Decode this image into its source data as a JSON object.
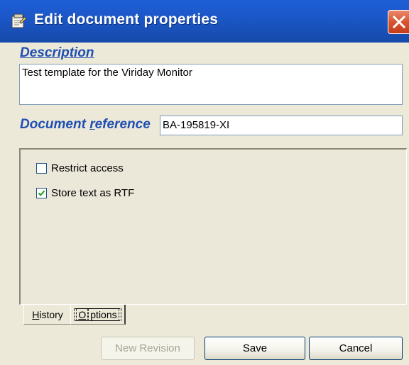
{
  "window": {
    "title": "Edit document properties",
    "icons": {
      "app": "properties-icon",
      "close": "close-icon"
    }
  },
  "description": {
    "label": "Description",
    "value": "Test template for the Viriday Monitor"
  },
  "reference": {
    "label_prefix": "Document ",
    "label_hotkey": "r",
    "label_suffix": "eference",
    "value": "BA-195819-XI"
  },
  "options": {
    "restrict_access": {
      "label": "Restrict access",
      "checked": false
    },
    "store_rtf": {
      "label": "Store text as RTF",
      "checked": true
    }
  },
  "tabs": {
    "history_hotkey": "H",
    "history_rest": "istory",
    "options_hotkey": "O",
    "options_rest": "ptions",
    "active": "Options"
  },
  "buttons": {
    "new_revision": "New Revision",
    "save": "Save",
    "cancel": "Cancel"
  },
  "colors": {
    "titlebar": "#1b56c6",
    "label_blue": "#1f4fb4",
    "dialog_bg": "#ece9d8",
    "close_red": "#d8542f"
  }
}
